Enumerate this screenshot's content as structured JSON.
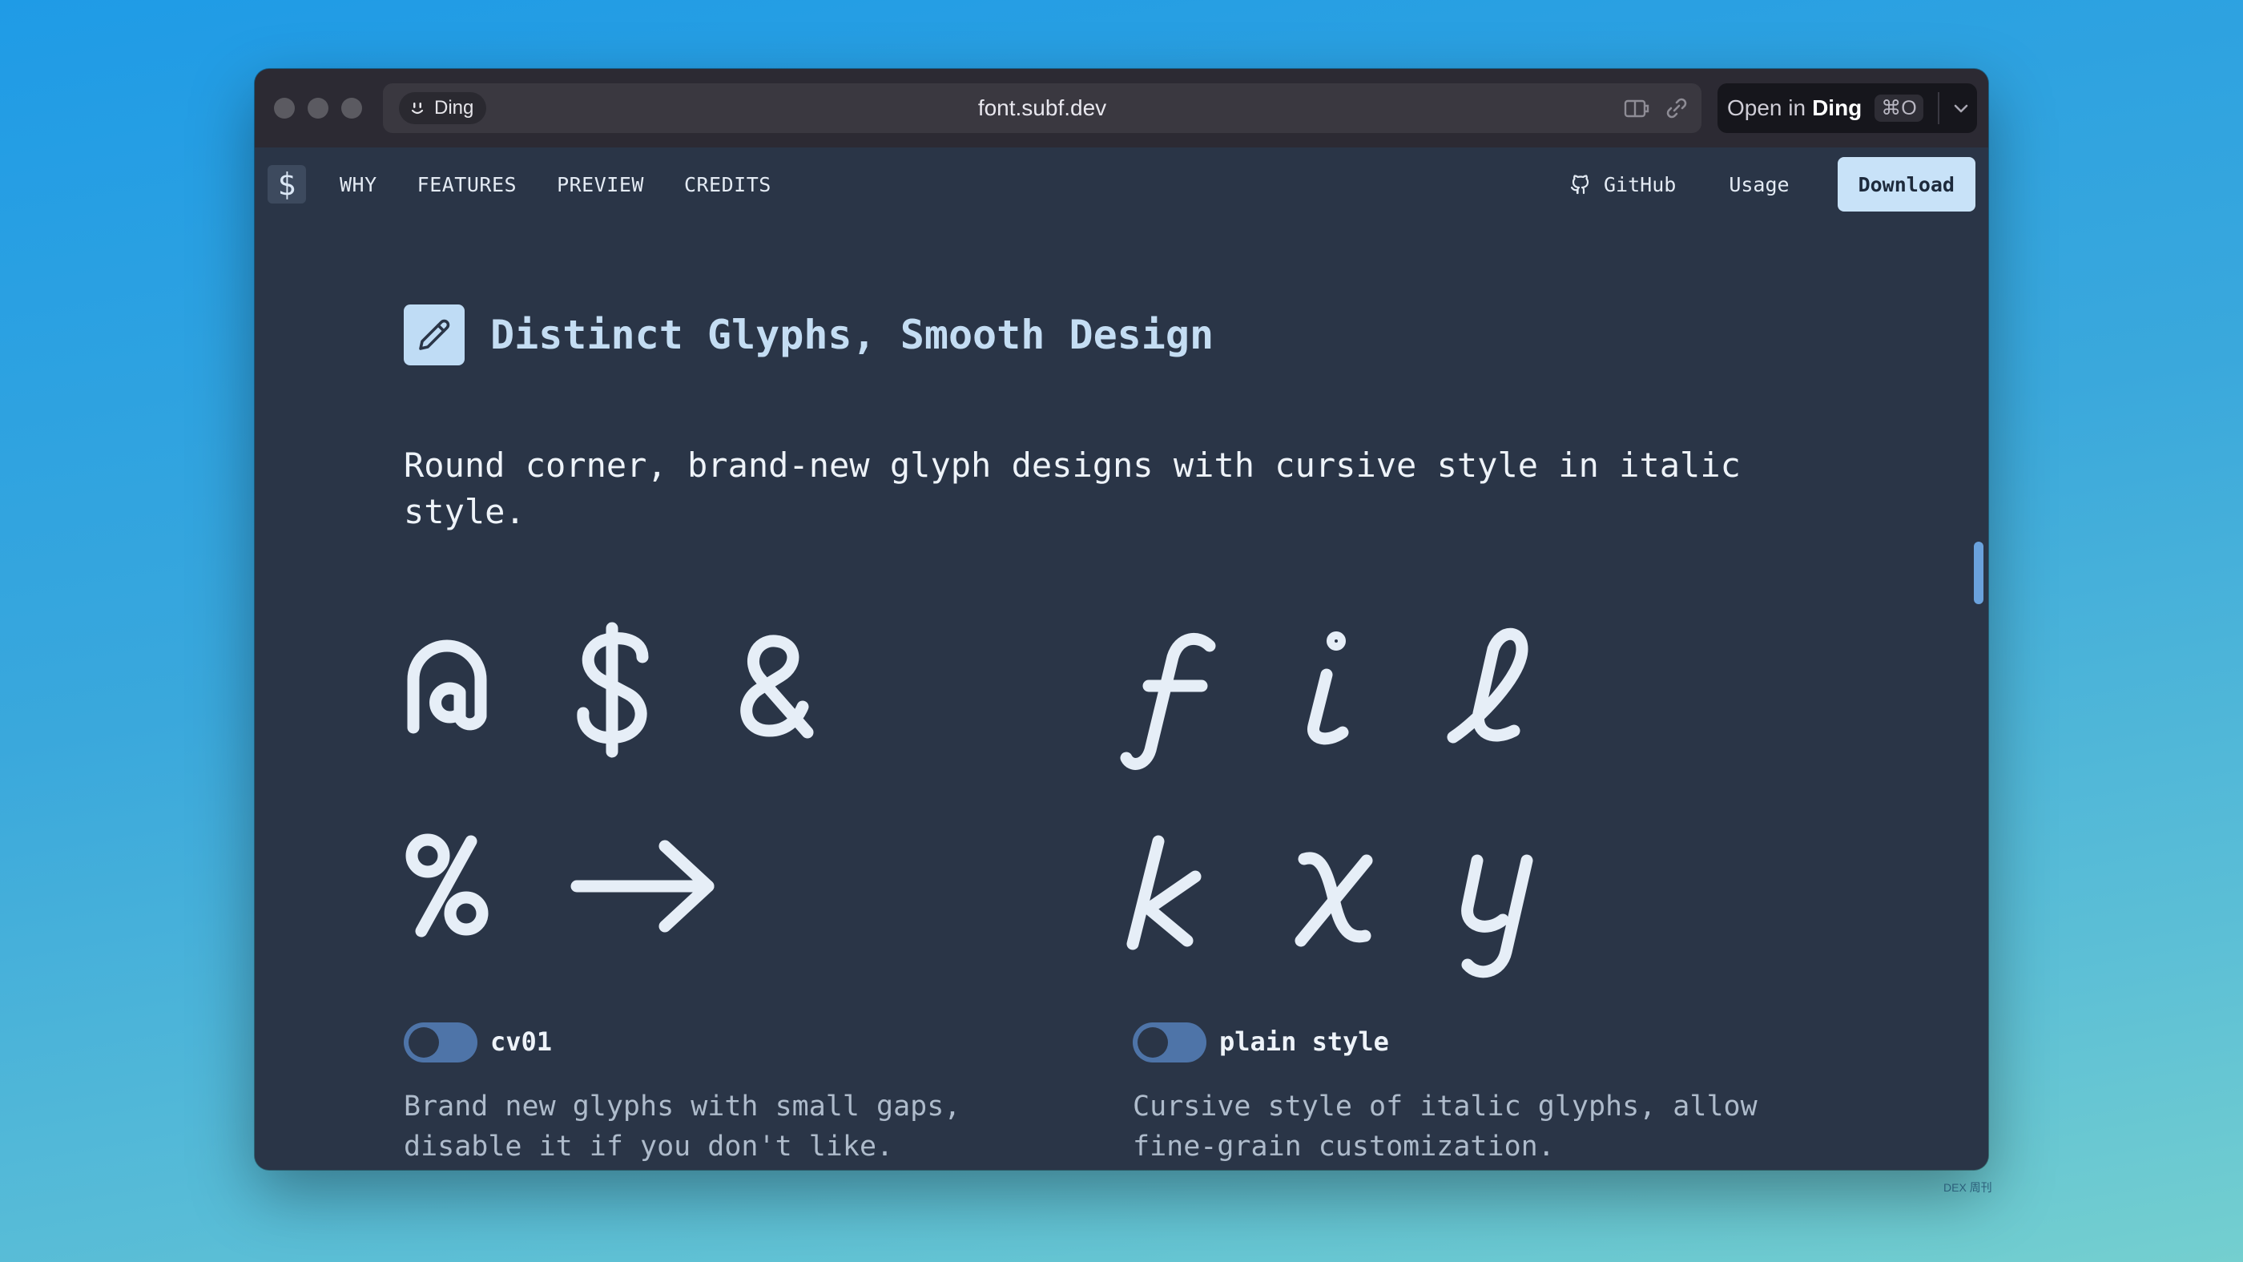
{
  "browser": {
    "tab_app": "Ding",
    "url": "font.subf.dev",
    "open_in_prefix": "Open in",
    "open_in_app": "Ding",
    "open_shortcut": "⌘O"
  },
  "nav": {
    "logo_glyph": "$",
    "links": [
      "WHY",
      "FEATURES",
      "PREVIEW",
      "CREDITS"
    ],
    "github": "GitHub",
    "usage": "Usage",
    "download": "Download"
  },
  "section": {
    "title": "Distinct Glyphs, Smooth Design",
    "description": "Round corner, brand-new glyph designs with cursive style in italic style."
  },
  "features": [
    {
      "toggle_label": "cv01",
      "toggle_on": false,
      "description": "Brand new glyphs with small gaps, disable it if you don't like.",
      "glyph_icons": [
        "at-sign-glyph",
        "dollar-sign-glyph",
        "ampersand-glyph",
        "percent-glyph",
        "right-arrow-glyph"
      ]
    },
    {
      "toggle_label": "plain style",
      "toggle_on": false,
      "description": "Cursive style of italic glyphs, allow fine-grain customization.",
      "glyph_icons": [
        "italic-f-glyph",
        "italic-i-glyph",
        "italic-l-glyph",
        "italic-k-glyph",
        "italic-x-glyph",
        "italic-y-glyph"
      ]
    }
  ],
  "colors": {
    "page_bg": "#2a3547",
    "accent": "#c8e2f8",
    "toggle_track": "#4e74a8",
    "title_text": "#c4ddf3"
  },
  "watermark": "DEX 周刊"
}
